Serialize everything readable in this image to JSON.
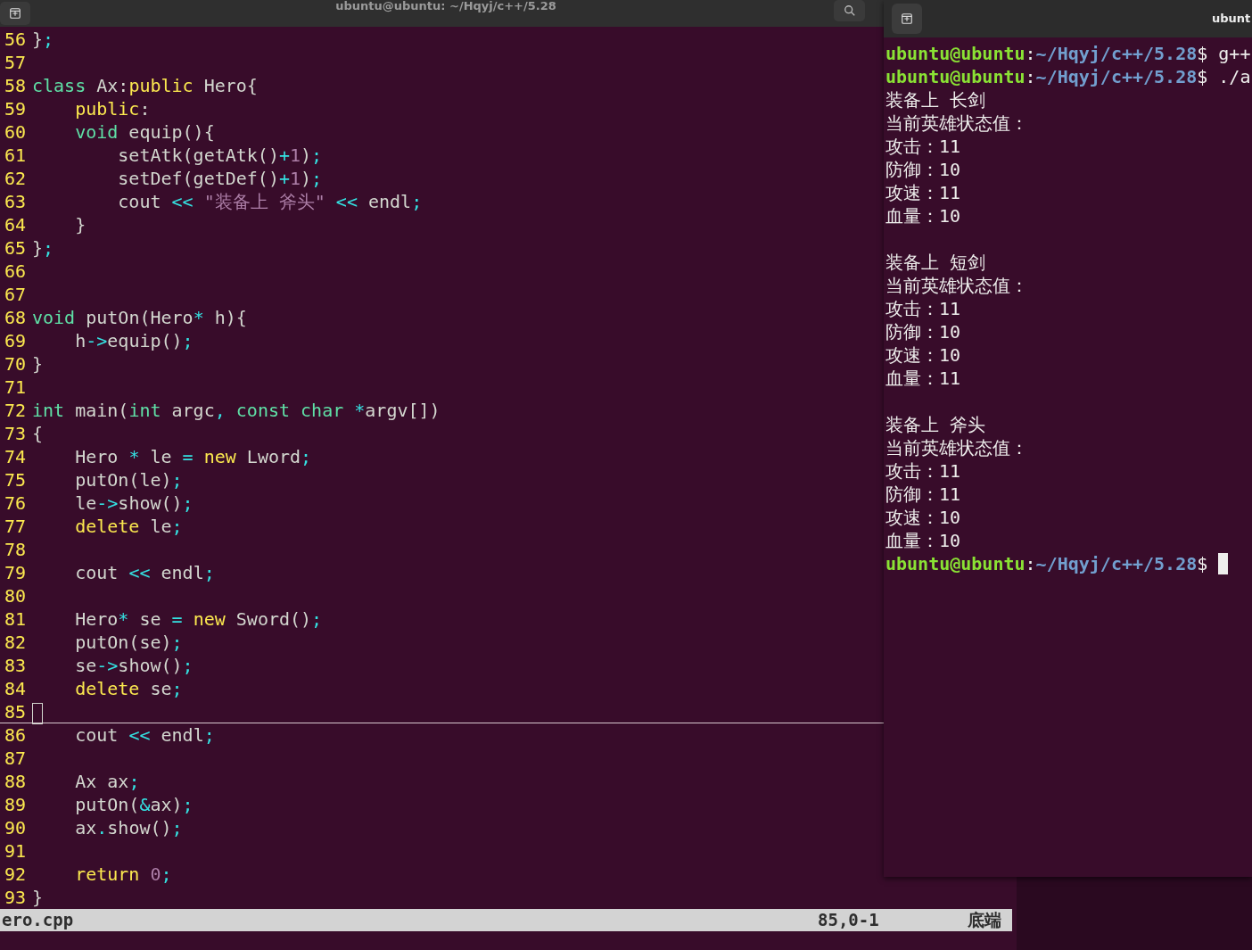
{
  "editor": {
    "title": "ubuntu@ubuntu: ~/Hqyj/c++/5.28",
    "lines": [
      {
        "number": "56",
        "current": false,
        "tokens": [
          {
            "kind": "plain",
            "text": "}"
          },
          {
            "kind": "operator",
            "text": ";"
          }
        ]
      },
      {
        "number": "57",
        "current": false
      },
      {
        "number": "58",
        "current": false,
        "tokens": [
          {
            "kind": "keyword",
            "text": "class"
          },
          {
            "kind": "plain",
            "text": " Ax:"
          },
          {
            "kind": "statement",
            "text": "public"
          },
          {
            "kind": "plain",
            "text": " Hero{"
          }
        ]
      },
      {
        "number": "59",
        "current": false,
        "tokens": [
          {
            "kind": "statement",
            "text": "    public"
          },
          {
            "kind": "plain",
            "text": ":"
          }
        ]
      },
      {
        "number": "60",
        "current": false,
        "tokens": [
          {
            "kind": "keyword",
            "text": "    void"
          },
          {
            "kind": "plain",
            "text": " equip(){"
          }
        ]
      },
      {
        "number": "61",
        "current": false,
        "tokens": [
          {
            "kind": "plain",
            "text": "        setAtk(getAtk()"
          },
          {
            "kind": "operator",
            "text": "+"
          },
          {
            "kind": "literal",
            "text": "1"
          },
          {
            "kind": "plain",
            "text": ")"
          },
          {
            "kind": "operator",
            "text": ";"
          }
        ]
      },
      {
        "number": "62",
        "current": false,
        "tokens": [
          {
            "kind": "plain",
            "text": "        setDef(getDef()"
          },
          {
            "kind": "operator",
            "text": "+"
          },
          {
            "kind": "literal",
            "text": "1"
          },
          {
            "kind": "plain",
            "text": ")"
          },
          {
            "kind": "operator",
            "text": ";"
          }
        ]
      },
      {
        "number": "63",
        "current": false,
        "tokens": [
          {
            "kind": "plain",
            "text": "        cout "
          },
          {
            "kind": "operator",
            "text": "<< "
          },
          {
            "kind": "literal",
            "text": "\"装备上 斧头\" "
          },
          {
            "kind": "operator",
            "text": "<<"
          },
          {
            "kind": "plain",
            "text": " endl"
          },
          {
            "kind": "operator",
            "text": ";"
          }
        ]
      },
      {
        "number": "64",
        "current": false,
        "tokens": [
          {
            "kind": "plain",
            "text": "    }"
          }
        ]
      },
      {
        "number": "65",
        "current": false,
        "tokens": [
          {
            "kind": "plain",
            "text": "}"
          },
          {
            "kind": "operator",
            "text": ";"
          }
        ]
      },
      {
        "number": "66",
        "current": false
      },
      {
        "number": "67",
        "current": false
      },
      {
        "number": "68",
        "current": false,
        "tokens": [
          {
            "kind": "keyword",
            "text": "void"
          },
          {
            "kind": "plain",
            "text": " putOn(Hero"
          },
          {
            "kind": "operator",
            "text": "*"
          },
          {
            "kind": "plain",
            "text": " h){"
          }
        ]
      },
      {
        "number": "69",
        "current": false,
        "tokens": [
          {
            "kind": "plain",
            "text": "    h"
          },
          {
            "kind": "operator",
            "text": "->"
          },
          {
            "kind": "plain",
            "text": "equip()"
          },
          {
            "kind": "operator",
            "text": ";"
          }
        ]
      },
      {
        "number": "70",
        "current": false,
        "tokens": [
          {
            "kind": "plain",
            "text": "}"
          }
        ]
      },
      {
        "number": "71",
        "current": false
      },
      {
        "number": "72",
        "current": false,
        "tokens": [
          {
            "kind": "keyword",
            "text": "int"
          },
          {
            "kind": "plain",
            "text": " main("
          },
          {
            "kind": "keyword",
            "text": "int"
          },
          {
            "kind": "plain",
            "text": " argc"
          },
          {
            "kind": "operator",
            "text": ", "
          },
          {
            "kind": "keyword",
            "text": "const char "
          },
          {
            "kind": "operator",
            "text": "*"
          },
          {
            "kind": "plain",
            "text": "argv[])"
          }
        ]
      },
      {
        "number": "73",
        "current": false,
        "tokens": [
          {
            "kind": "plain",
            "text": "{"
          }
        ]
      },
      {
        "number": "74",
        "current": false,
        "tokens": [
          {
            "kind": "plain",
            "text": "    Hero "
          },
          {
            "kind": "operator",
            "text": "*"
          },
          {
            "kind": "plain",
            "text": " le "
          },
          {
            "kind": "operator",
            "text": "= "
          },
          {
            "kind": "statement",
            "text": "new"
          },
          {
            "kind": "plain",
            "text": " Lword"
          },
          {
            "kind": "operator",
            "text": ";"
          }
        ]
      },
      {
        "number": "75",
        "current": false,
        "tokens": [
          {
            "kind": "plain",
            "text": "    putOn(le)"
          },
          {
            "kind": "operator",
            "text": ";"
          }
        ]
      },
      {
        "number": "76",
        "current": false,
        "tokens": [
          {
            "kind": "plain",
            "text": "    le"
          },
          {
            "kind": "operator",
            "text": "->"
          },
          {
            "kind": "plain",
            "text": "show()"
          },
          {
            "kind": "operator",
            "text": ";"
          }
        ]
      },
      {
        "number": "77",
        "current": false,
        "tokens": [
          {
            "kind": "statement",
            "text": "    delete"
          },
          {
            "kind": "plain",
            "text": " le"
          },
          {
            "kind": "operator",
            "text": ";"
          }
        ]
      },
      {
        "number": "78",
        "current": false
      },
      {
        "number": "79",
        "current": false,
        "tokens": [
          {
            "kind": "plain",
            "text": "    cout "
          },
          {
            "kind": "operator",
            "text": "<<"
          },
          {
            "kind": "plain",
            "text": " endl"
          },
          {
            "kind": "operator",
            "text": ";"
          }
        ]
      },
      {
        "number": "80",
        "current": false
      },
      {
        "number": "81",
        "current": false,
        "tokens": [
          {
            "kind": "plain",
            "text": "    Hero"
          },
          {
            "kind": "operator",
            "text": "*"
          },
          {
            "kind": "plain",
            "text": " se "
          },
          {
            "kind": "operator",
            "text": "= "
          },
          {
            "kind": "statement",
            "text": "new"
          },
          {
            "kind": "plain",
            "text": " Sword()"
          },
          {
            "kind": "operator",
            "text": ";"
          }
        ]
      },
      {
        "number": "82",
        "current": false,
        "tokens": [
          {
            "kind": "plain",
            "text": "    putOn(se)"
          },
          {
            "kind": "operator",
            "text": ";"
          }
        ]
      },
      {
        "number": "83",
        "current": false,
        "tokens": [
          {
            "kind": "plain",
            "text": "    se"
          },
          {
            "kind": "operator",
            "text": "->"
          },
          {
            "kind": "plain",
            "text": "show()"
          },
          {
            "kind": "operator",
            "text": ";"
          }
        ]
      },
      {
        "number": "84",
        "current": false,
        "tokens": [
          {
            "kind": "statement",
            "text": "    delete"
          },
          {
            "kind": "plain",
            "text": " se"
          },
          {
            "kind": "operator",
            "text": ";"
          }
        ]
      },
      {
        "number": "85",
        "current": true
      },
      {
        "number": "86",
        "current": false,
        "tokens": [
          {
            "kind": "plain",
            "text": "    cout "
          },
          {
            "kind": "operator",
            "text": "<<"
          },
          {
            "kind": "plain",
            "text": " endl"
          },
          {
            "kind": "operator",
            "text": ";"
          }
        ]
      },
      {
        "number": "87",
        "current": false
      },
      {
        "number": "88",
        "current": false,
        "tokens": [
          {
            "kind": "plain",
            "text": "    Ax ax"
          },
          {
            "kind": "operator",
            "text": ";"
          }
        ]
      },
      {
        "number": "89",
        "current": false,
        "tokens": [
          {
            "kind": "plain",
            "text": "    putOn("
          },
          {
            "kind": "operator",
            "text": "&"
          },
          {
            "kind": "plain",
            "text": "ax)"
          },
          {
            "kind": "operator",
            "text": ";"
          }
        ]
      },
      {
        "number": "90",
        "current": false,
        "tokens": [
          {
            "kind": "plain",
            "text": "    ax"
          },
          {
            "kind": "operator",
            "text": "."
          },
          {
            "kind": "plain",
            "text": "show()"
          },
          {
            "kind": "operator",
            "text": ";"
          }
        ]
      },
      {
        "number": "91",
        "current": false
      },
      {
        "number": "92",
        "current": false,
        "tokens": [
          {
            "kind": "statement",
            "text": "    return "
          },
          {
            "kind": "literal",
            "text": "0"
          },
          {
            "kind": "operator",
            "text": ";"
          }
        ]
      },
      {
        "number": "93",
        "current": false,
        "tokens": [
          {
            "kind": "plain",
            "text": "}"
          }
        ]
      }
    ],
    "status_bar": {
      "file": "ero.cpp",
      "position": "85,0-1",
      "scroll": "底端"
    }
  },
  "terminal": {
    "title": "ubunt",
    "lines": [
      {
        "kind": "prompt",
        "user": "ubuntu@ubuntu",
        "separator": ":",
        "path": "~/Hqyj/c++/5.28",
        "command": "$ g++",
        "cursor": false
      },
      {
        "kind": "prompt",
        "user": "ubuntu@ubuntu",
        "separator": ":",
        "path": "~/Hqyj/c++/5.28",
        "command": "$ ./a",
        "cursor": false
      },
      {
        "kind": "output",
        "text": "装备上 长剑"
      },
      {
        "kind": "output",
        "text": "当前英雄状态值："
      },
      {
        "kind": "output",
        "text": "攻击：11"
      },
      {
        "kind": "output",
        "text": "防御：10"
      },
      {
        "kind": "output",
        "text": "攻速：11"
      },
      {
        "kind": "output",
        "text": "血量：10"
      },
      {
        "kind": "blank"
      },
      {
        "kind": "output",
        "text": "装备上 短剑"
      },
      {
        "kind": "output",
        "text": "当前英雄状态值："
      },
      {
        "kind": "output",
        "text": "攻击：11"
      },
      {
        "kind": "output",
        "text": "防御：10"
      },
      {
        "kind": "output",
        "text": "攻速：10"
      },
      {
        "kind": "output",
        "text": "血量：11"
      },
      {
        "kind": "blank"
      },
      {
        "kind": "output",
        "text": "装备上 斧头"
      },
      {
        "kind": "output",
        "text": "当前英雄状态值："
      },
      {
        "kind": "output",
        "text": "攻击：11"
      },
      {
        "kind": "output",
        "text": "防御：11"
      },
      {
        "kind": "output",
        "text": "攻速：10"
      },
      {
        "kind": "output",
        "text": "血量：10"
      },
      {
        "kind": "prompt",
        "user": "ubuntu@ubuntu",
        "separator": ":",
        "path": "~/Hqyj/c++/5.28",
        "command": "$",
        "cursor": true
      }
    ]
  }
}
